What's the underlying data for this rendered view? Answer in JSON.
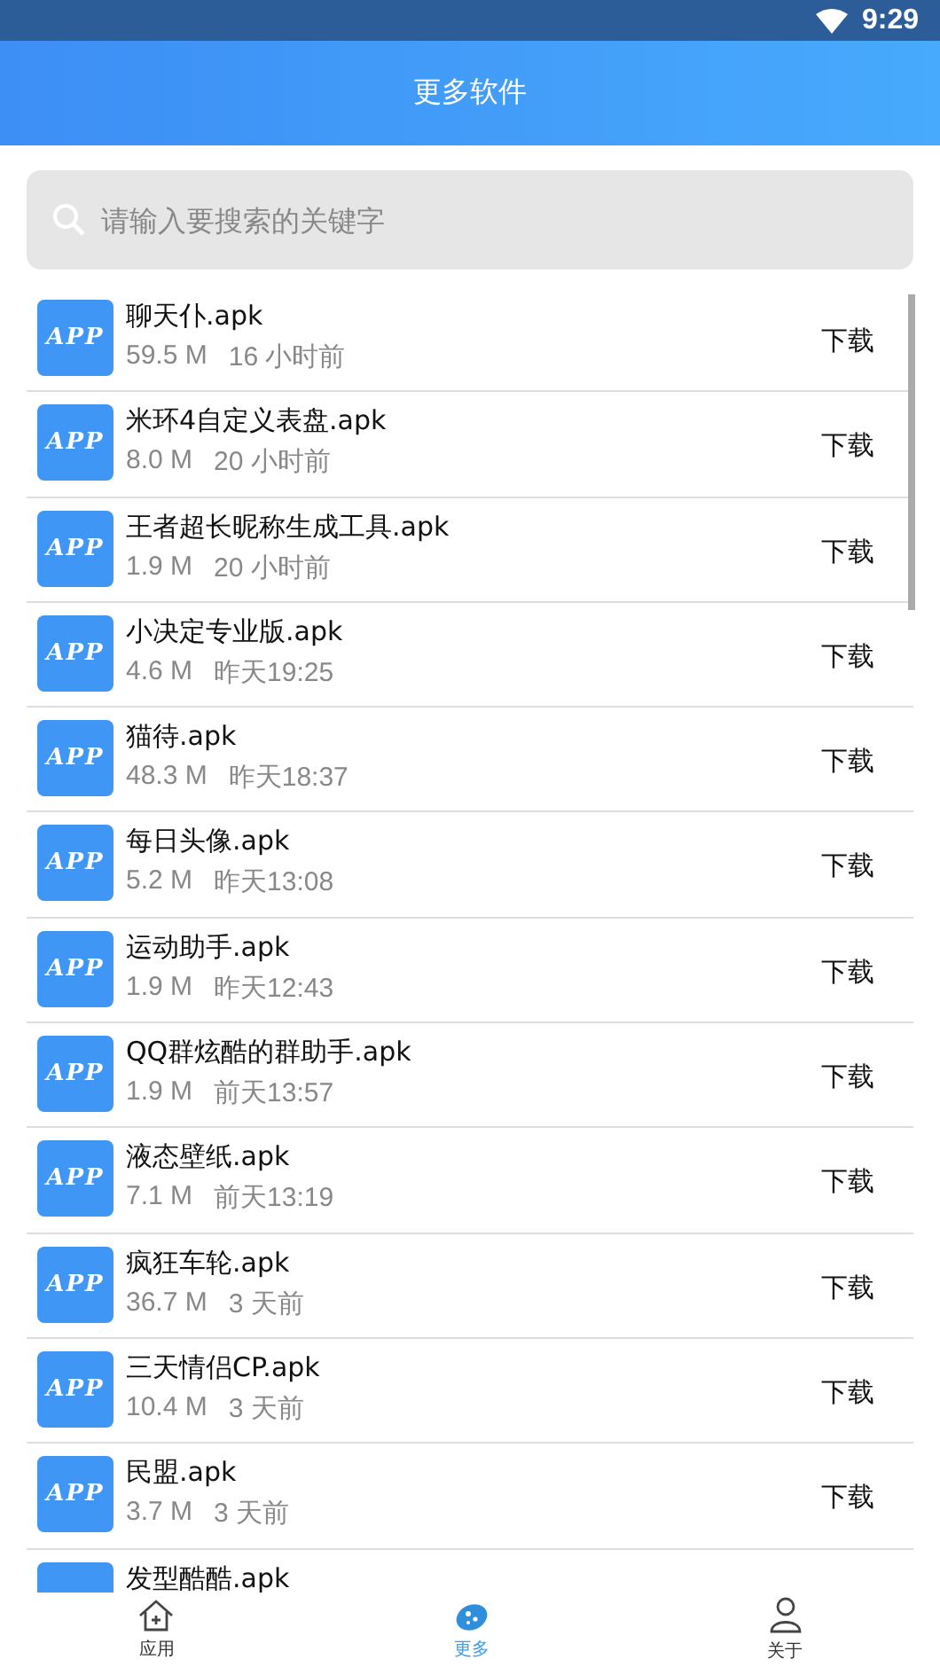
{
  "status_bar": {
    "time": "9:29"
  },
  "header": {
    "title": "更多软件"
  },
  "search": {
    "placeholder": "请输入要搜索的关键字"
  },
  "apps": [
    {
      "icon_text": "APP",
      "name": "聊天仆.apk",
      "size": "59.5 M",
      "time": "16 小时前",
      "action": "下载"
    },
    {
      "icon_text": "APP",
      "name": "米环4自定义表盘.apk",
      "size": "8.0 M",
      "time": "20 小时前",
      "action": "下载"
    },
    {
      "icon_text": "APP",
      "name": "王者超长昵称生成工具.apk",
      "size": "1.9 M",
      "time": "20 小时前",
      "action": "下载"
    },
    {
      "icon_text": "APP",
      "name": "小决定专业版.apk",
      "size": "4.6 M",
      "time": "昨天19:25",
      "action": "下载"
    },
    {
      "icon_text": "APP",
      "name": "猫待.apk",
      "size": "48.3 M",
      "time": "昨天18:37",
      "action": "下载"
    },
    {
      "icon_text": "APP",
      "name": "每日头像.apk",
      "size": "5.2 M",
      "time": "昨天13:08",
      "action": "下载"
    },
    {
      "icon_text": "APP",
      "name": "运动助手.apk",
      "size": "1.9 M",
      "time": "昨天12:43",
      "action": "下载"
    },
    {
      "icon_text": "APP",
      "name": "QQ群炫酷的群助手.apk",
      "size": "1.9 M",
      "time": "前天13:57",
      "action": "下载"
    },
    {
      "icon_text": "APP",
      "name": "液态壁纸.apk",
      "size": "7.1 M",
      "time": "前天13:19",
      "action": "下载"
    },
    {
      "icon_text": "APP",
      "name": "疯狂车轮.apk",
      "size": "36.7 M",
      "time": "3 天前",
      "action": "下载"
    },
    {
      "icon_text": "APP",
      "name": "三天情侣CP.apk",
      "size": "10.4 M",
      "time": "3 天前",
      "action": "下载"
    },
    {
      "icon_text": "APP",
      "name": "民盟.apk",
      "size": "3.7 M",
      "time": "3 天前",
      "action": "下载"
    },
    {
      "name": "发型酷酷.apk"
    }
  ],
  "bottom_nav": [
    {
      "kind": "home",
      "label": "应用",
      "selected": false
    },
    {
      "kind": "more",
      "label": "更多",
      "selected": true
    },
    {
      "kind": "person",
      "label": "关于",
      "selected": false
    }
  ]
}
